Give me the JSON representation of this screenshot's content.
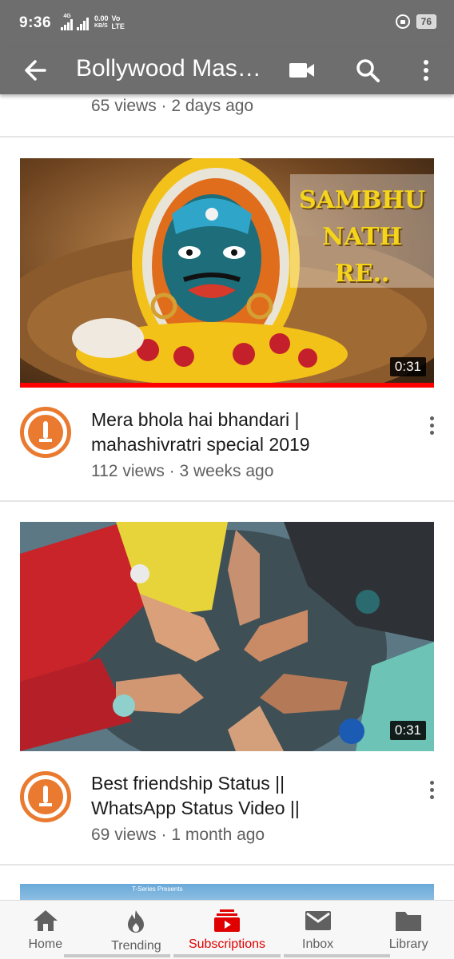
{
  "status_bar": {
    "time": "9:36",
    "network": "4G",
    "speed": "0.00",
    "speed_unit": "KB/S",
    "vo": "Vo",
    "lte": "LTE",
    "battery": "76"
  },
  "app_bar": {
    "title": "Bollywood Mas…",
    "icons": [
      "back-arrow-icon",
      "camera-icon",
      "search-icon",
      "more-vert-icon"
    ]
  },
  "feed": {
    "previous_meta": "65 views · 2 days ago",
    "videos": [
      {
        "thumbnail_text": [
          "SAMBHU",
          "NATH",
          "RE.."
        ],
        "duration": "0:31",
        "watched_progress": 1.0,
        "title_line1": "Mera bhola hai bhandari |",
        "title_line2": "mahashivratri special 2019",
        "meta": "112 views · 3 weeks ago"
      },
      {
        "duration": "0:31",
        "title_line1": "Best friendship Status ||",
        "title_line2": "WhatsApp Status Video ||",
        "meta": "69 views · 1 month ago"
      }
    ],
    "peek_text": "T-Series Presents"
  },
  "bottom_nav": {
    "items": [
      {
        "label": "Home",
        "icon": "home-icon"
      },
      {
        "label": "Trending",
        "icon": "flame-icon"
      },
      {
        "label": "Subscriptions",
        "icon": "subscriptions-icon"
      },
      {
        "label": "Inbox",
        "icon": "mail-icon"
      },
      {
        "label": "Library",
        "icon": "folder-icon"
      }
    ],
    "active": "Subscriptions"
  },
  "colors": {
    "app_bar": "#6e6e6e",
    "accent_red": "#e00000",
    "channel_orange": "#e97a2f",
    "thumb_text_yellow": "#f5d41c"
  }
}
